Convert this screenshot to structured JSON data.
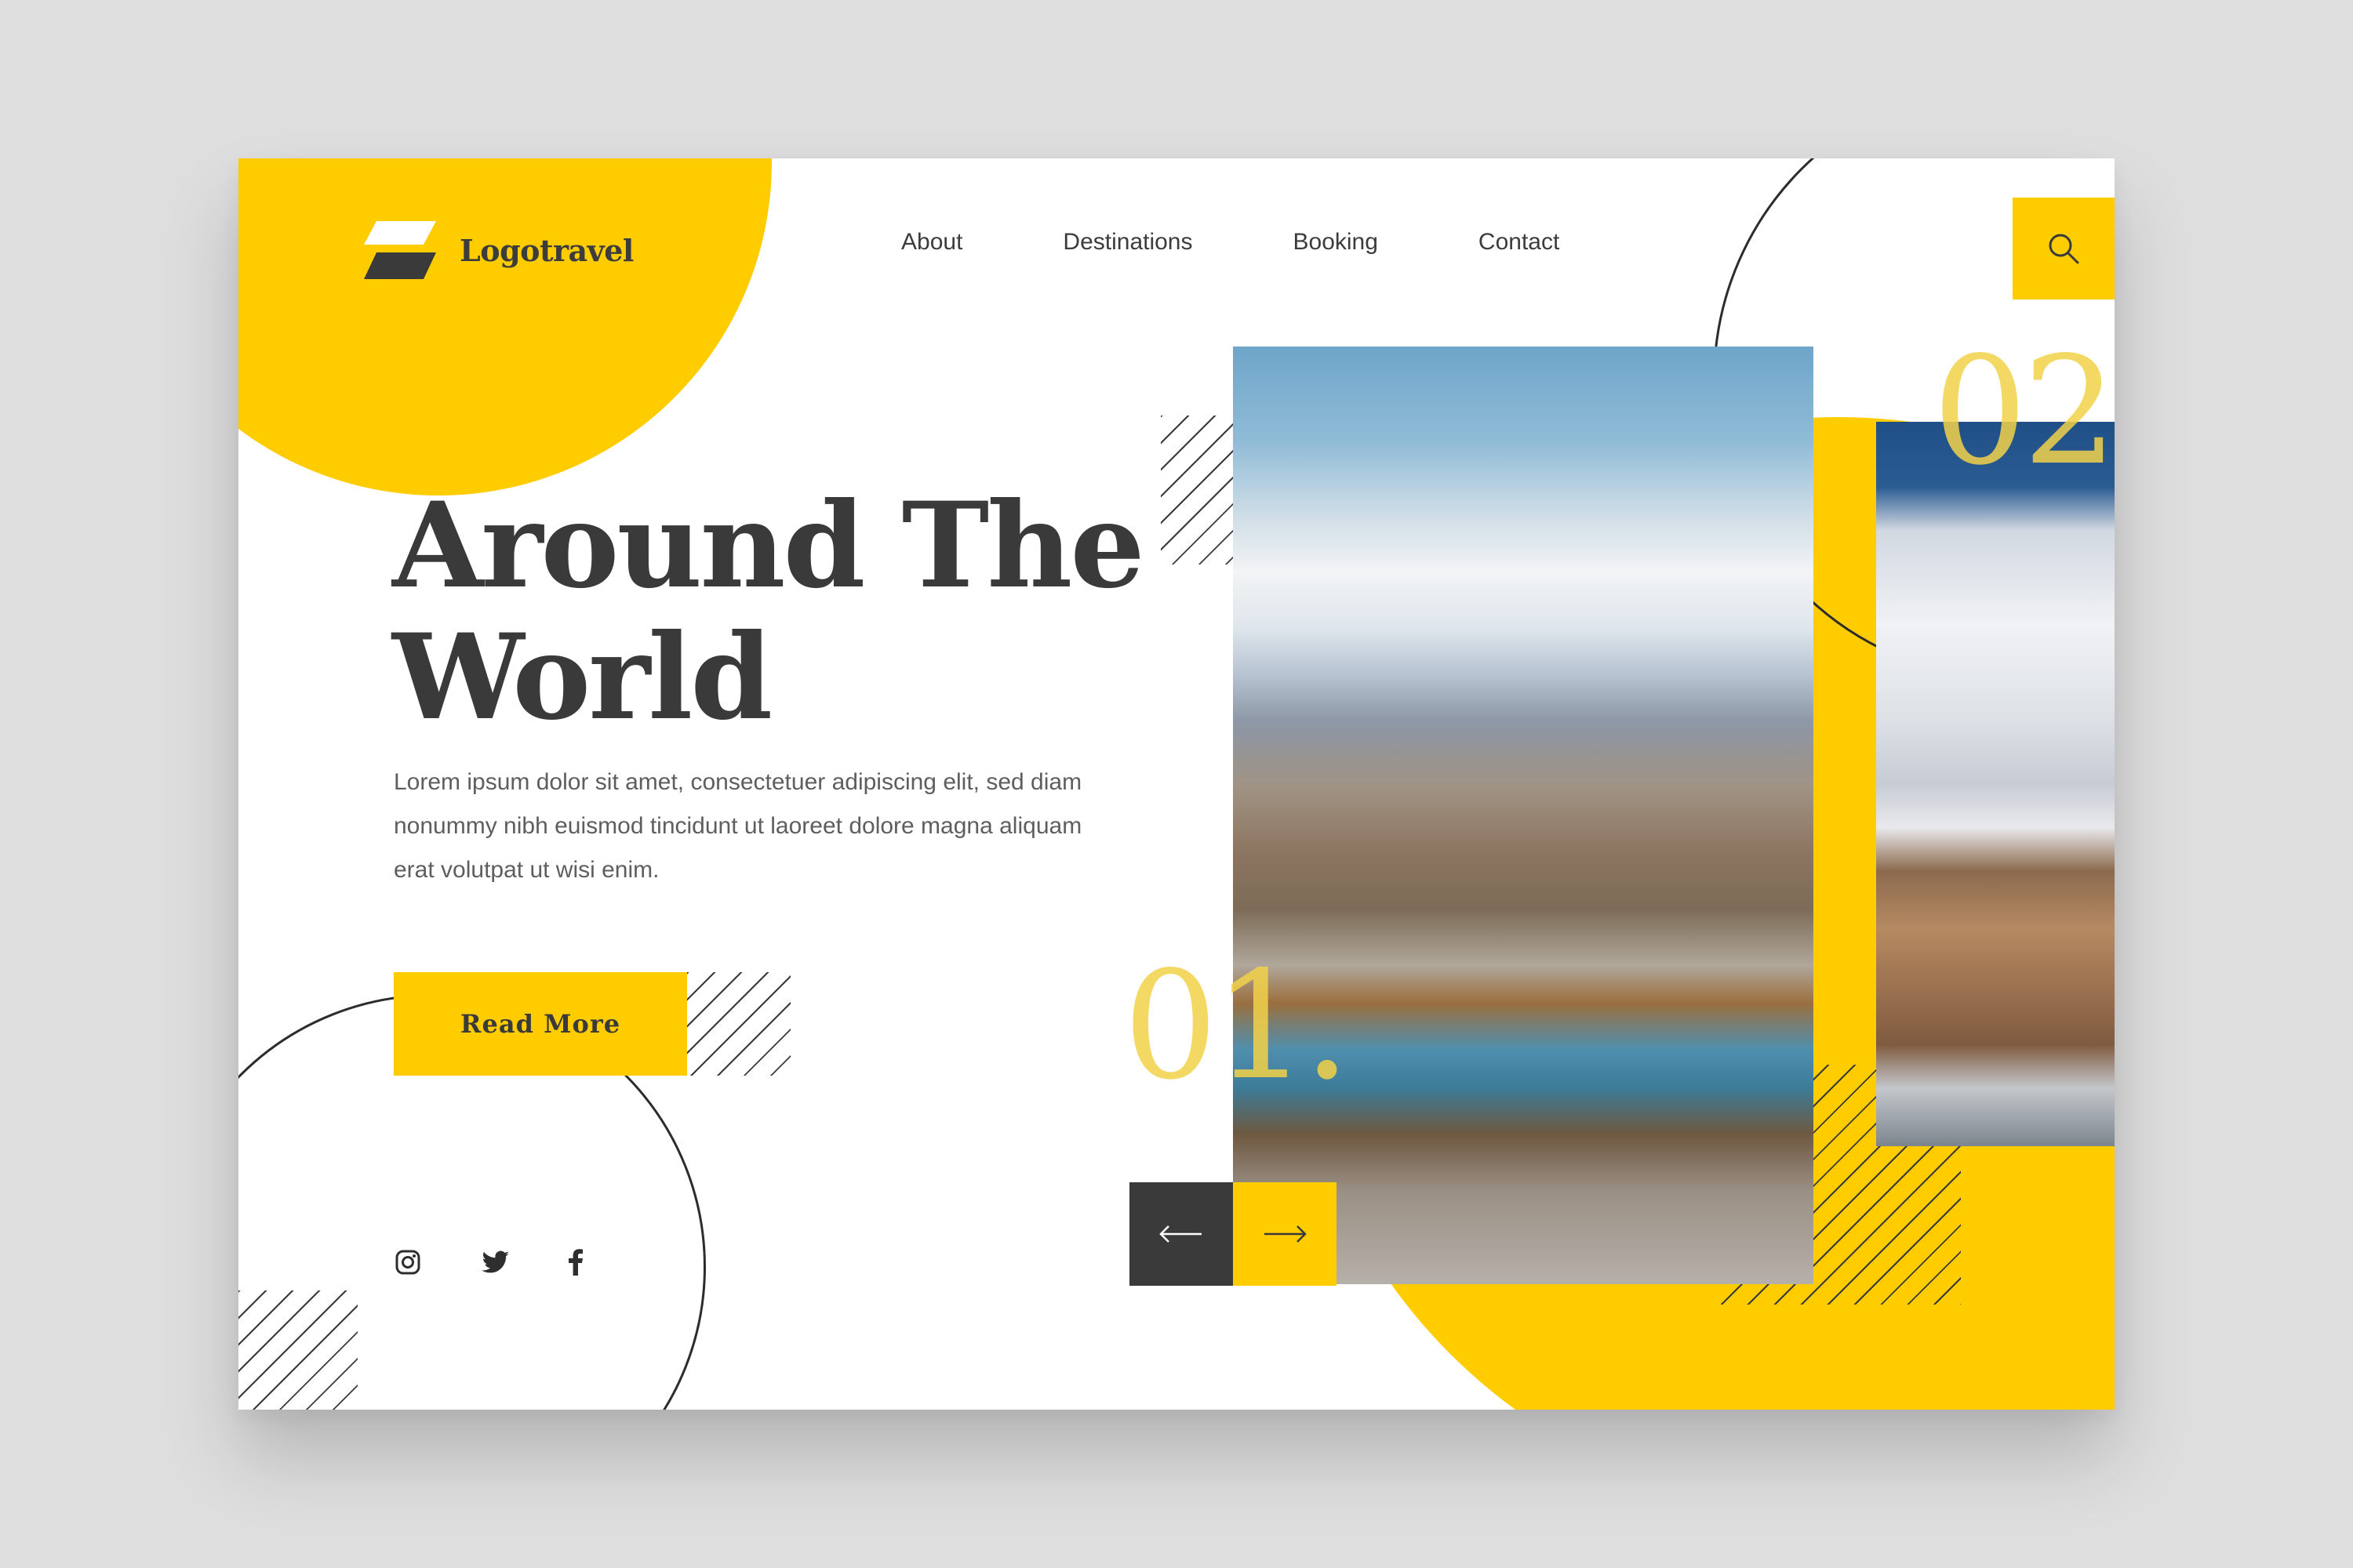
{
  "brand": {
    "name": "Logotravel",
    "logo_icon": "logo-mark-icon"
  },
  "nav": {
    "items": [
      {
        "label": "About"
      },
      {
        "label": "Destinations"
      },
      {
        "label": "Booking"
      },
      {
        "label": "Contact"
      }
    ],
    "search_icon": "search-icon"
  },
  "hero": {
    "title_line1": "Around The",
    "title_line2": "World",
    "body": "Lorem ipsum dolor sit amet, consectetuer adipiscing elit, sed diam nonummy nibh euismod tincidunt ut laoreet dolore magna aliquam erat volutpat ut wisi enim.",
    "cta_label": "Read More"
  },
  "social": [
    "instagram-icon",
    "twitter-icon",
    "facebook-icon"
  ],
  "slider": {
    "slides": [
      {
        "number": "01."
      },
      {
        "number": "02"
      }
    ],
    "prev_icon": "arrow-left-icon",
    "next_icon": "arrow-right-icon"
  },
  "colors": {
    "accent": "#ffcc00",
    "dark": "#3a3a3a",
    "text": "#5e5e5e",
    "background": "#ffffff",
    "canvas": "#dededf"
  }
}
